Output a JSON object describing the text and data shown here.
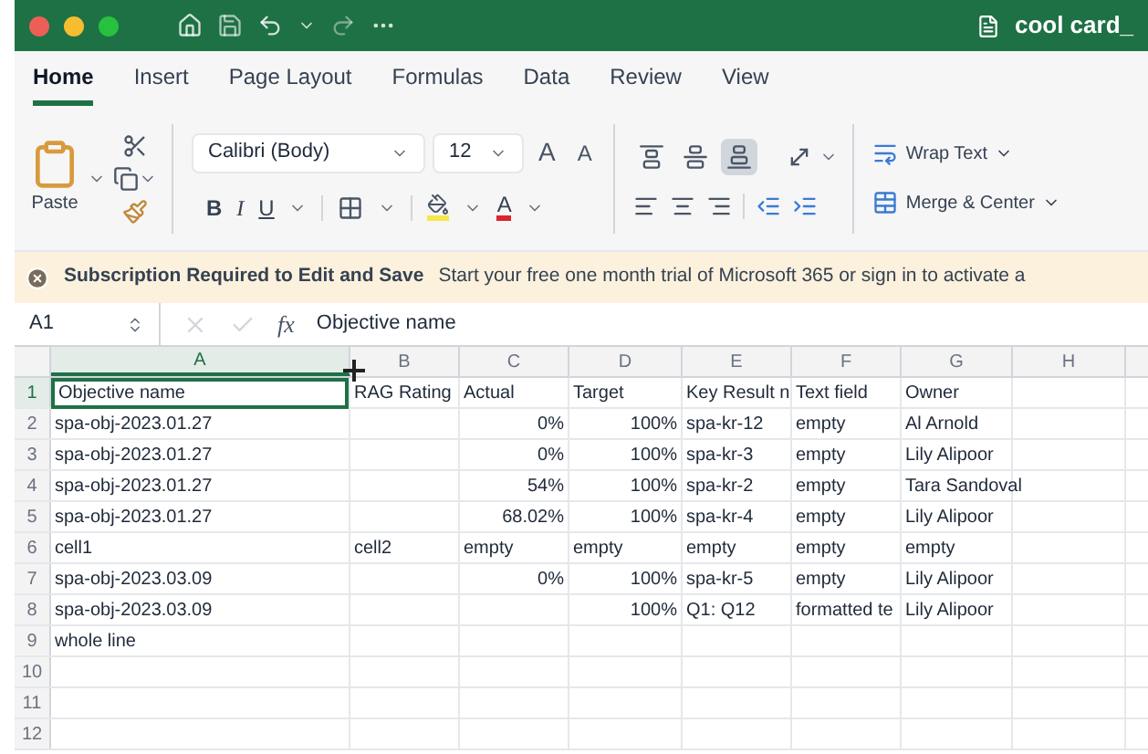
{
  "window": {
    "title": "cool card_"
  },
  "tabs": [
    {
      "label": "Home",
      "selected": true
    },
    {
      "label": "Insert",
      "selected": false
    },
    {
      "label": "Page Layout",
      "selected": false
    },
    {
      "label": "Formulas",
      "selected": false
    },
    {
      "label": "Data",
      "selected": false
    },
    {
      "label": "Review",
      "selected": false
    },
    {
      "label": "View",
      "selected": false
    }
  ],
  "ribbon": {
    "paste_label": "Paste",
    "font_name": "Calibri (Body)",
    "font_size": "12",
    "grow_font": "A",
    "shrink_font": "A",
    "bold": "B",
    "italic": "I",
    "underline": "U",
    "font_color": "A",
    "top_align_pressed": false,
    "middle_align_pressed": false,
    "bottom_align_pressed": true,
    "wrap_text": "Wrap Text",
    "merge_center": "Merge & Center"
  },
  "notice": {
    "title": "Subscription Required to Edit and Save",
    "message": "Start your free one month trial of Microsoft 365 or sign in to activate a"
  },
  "formula_bar": {
    "name_box": "A1",
    "fx": "fx",
    "value": "Objective name"
  },
  "sheet": {
    "columns": [
      {
        "label": "A",
        "selected": true
      },
      {
        "label": "B",
        "selected": false
      },
      {
        "label": "C",
        "selected": false
      },
      {
        "label": "D",
        "selected": false
      },
      {
        "label": "E",
        "selected": false
      },
      {
        "label": "F",
        "selected": false
      },
      {
        "label": "G",
        "selected": false
      },
      {
        "label": "H",
        "selected": false
      }
    ],
    "rows": [
      {
        "label": "1",
        "selected": true,
        "cells": [
          {
            "text": "Objective name",
            "selected": true
          },
          {
            "text": "RAG Rating"
          },
          {
            "text": "Actual"
          },
          {
            "text": "Target"
          },
          {
            "text": "Key Result n"
          },
          {
            "text": "Text field"
          },
          {
            "text": "Owner"
          },
          null
        ]
      },
      {
        "label": "2",
        "selected": false,
        "cells": [
          {
            "text": "spa-obj-2023.01.27"
          },
          null,
          {
            "text": "0%",
            "kind": "number"
          },
          {
            "text": "100%",
            "kind": "number"
          },
          {
            "text": "spa-kr-12"
          },
          {
            "text": "empty"
          },
          {
            "text": "Al Arnold"
          },
          null
        ]
      },
      {
        "label": "3",
        "selected": false,
        "cells": [
          {
            "text": "spa-obj-2023.01.27"
          },
          null,
          {
            "text": "0%",
            "kind": "number"
          },
          {
            "text": "100%",
            "kind": "number"
          },
          {
            "text": "spa-kr-3"
          },
          {
            "text": "empty"
          },
          {
            "text": "Lily Alipoor"
          },
          null
        ]
      },
      {
        "label": "4",
        "selected": false,
        "cells": [
          {
            "text": "spa-obj-2023.01.27"
          },
          null,
          {
            "text": "54%",
            "kind": "number"
          },
          {
            "text": "100%",
            "kind": "number"
          },
          {
            "text": "spa-kr-2"
          },
          {
            "text": "empty"
          },
          {
            "text": "Tara Sandoval"
          },
          null
        ]
      },
      {
        "label": "5",
        "selected": false,
        "cells": [
          {
            "text": "spa-obj-2023.01.27"
          },
          null,
          {
            "text": "68.02%",
            "kind": "number"
          },
          {
            "text": "100%",
            "kind": "number"
          },
          {
            "text": "spa-kr-4"
          },
          {
            "text": "empty"
          },
          {
            "text": "Lily Alipoor"
          },
          null
        ]
      },
      {
        "label": "6",
        "selected": false,
        "cells": [
          {
            "text": "cell1"
          },
          {
            "text": "cell2"
          },
          {
            "text": "empty"
          },
          {
            "text": "empty"
          },
          {
            "text": "empty"
          },
          {
            "text": "empty"
          },
          {
            "text": "empty"
          },
          null
        ]
      },
      {
        "label": "7",
        "selected": false,
        "cells": [
          {
            "text": "spa-obj-2023.03.09"
          },
          null,
          {
            "text": "0%",
            "kind": "number"
          },
          {
            "text": "100%",
            "kind": "number"
          },
          {
            "text": "spa-kr-5"
          },
          {
            "text": "empty"
          },
          {
            "text": "Lily Alipoor"
          },
          null
        ]
      },
      {
        "label": "8",
        "selected": false,
        "cells": [
          {
            "text": "spa-obj-2023.03.09"
          },
          null,
          null,
          {
            "text": "100%",
            "kind": "number"
          },
          {
            "text": "Q1: Q12"
          },
          {
            "text": "formatted te"
          },
          {
            "text": "Lily Alipoor"
          },
          null
        ]
      },
      {
        "label": "9",
        "selected": false,
        "cells": [
          {
            "text": "whole line"
          },
          null,
          null,
          null,
          null,
          null,
          null,
          null
        ]
      },
      {
        "label": "10",
        "selected": false,
        "cells": [
          null,
          null,
          null,
          null,
          null,
          null,
          null,
          null
        ]
      },
      {
        "label": "11",
        "selected": false,
        "cells": [
          null,
          null,
          null,
          null,
          null,
          null,
          null,
          null
        ]
      },
      {
        "label": "12",
        "selected": false,
        "cells": [
          null,
          null,
          null,
          null,
          null,
          null,
          null,
          null
        ]
      }
    ]
  }
}
